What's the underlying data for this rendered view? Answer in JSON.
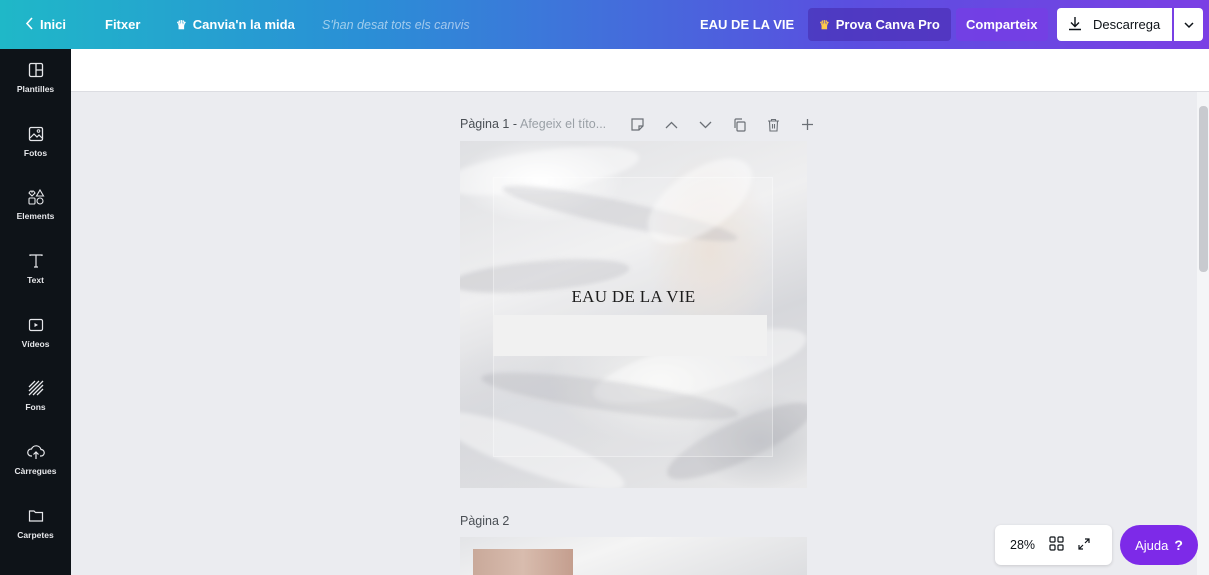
{
  "topbar": {
    "home_label": "Inici",
    "file_label": "Fitxer",
    "resize_label": "Canvia'n la mida",
    "saved_status": "S'han desat tots els canvis",
    "design_title": "EAU DE LA VIE",
    "pro_label": "Prova Canva Pro",
    "share_label": "Comparteix",
    "download_label": "Descarrega"
  },
  "sidebar": {
    "items": [
      {
        "label": "Plantilles",
        "icon": "templates-icon"
      },
      {
        "label": "Fotos",
        "icon": "photos-icon"
      },
      {
        "label": "Elements",
        "icon": "elements-icon"
      },
      {
        "label": "Text",
        "icon": "text-icon"
      },
      {
        "label": "Vídeos",
        "icon": "videos-icon"
      },
      {
        "label": "Fons",
        "icon": "background-icon"
      },
      {
        "label": "Càrregues",
        "icon": "uploads-icon"
      },
      {
        "label": "Carpetes",
        "icon": "folders-icon"
      }
    ]
  },
  "canvas": {
    "page1_label": "Pàgina 1 -",
    "page1_title_placeholder": "Afegeix el títo...",
    "page1_text": "EAU DE LA VIE",
    "page2_label": "Pàgina 2"
  },
  "zoom": {
    "level": "28%"
  },
  "help": {
    "label": "Ajuda",
    "q": "?"
  },
  "colors": {
    "accent": "#7d2ae8",
    "sidebar_bg": "#0e1318",
    "canvas_bg": "#ebecf0"
  }
}
